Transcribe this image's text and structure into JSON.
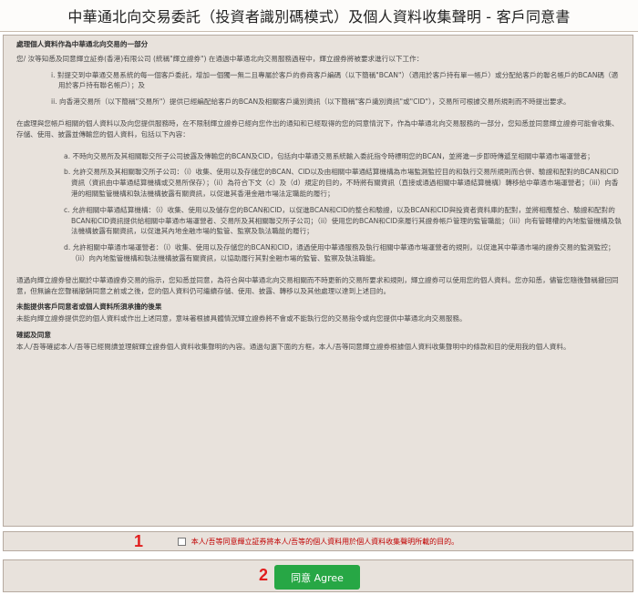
{
  "title": "中華通北向交易委託（投資者識別碼模式）及個人資料收集聲明 - 客戶同意書",
  "notice": {
    "heading1": "處理個人資料作為中華通北向交易的一部分",
    "intro": "您/ 汝等知悉及同意輝立証券(香港)有限公司 (統稱\"輝立證券\") 在通過中華通北向交易服務過程中，輝立證券將被要求進行以下工作：",
    "roman_i": "i. 對提交到中華通交易系統的每一個客戶委託，增加一個獨一無二且專屬於客戶的券商客戶編碼（以下簡稱\"BCAN\"）（適用於客戶持有單一帳戶）或分配給客戶的聯名帳戶的BCAN碼（適用於客戶持有聯名帳戶）；及",
    "roman_ii": "ii. 向香港交易所（以下簡稱\"交易所\"）提供已經編配給客戶的BCAN及相關客戶識別資訊（以下簡稱\"客戶識別資訊\"或\"CID\"），交易所可根據交易所規則而不時提出要求。",
    "para2": "在處理與您帳戶相關的個人資料以及向您提供服務時，在不限制輝立證券已經向您作出的通知和已經取得的您的同意情況下，作為中華通北向交易服務的一部分，您知悉並同意輝立證券可能會收集、存儲、使用、披露並傳輸您的個人資料，包括以下內容：",
    "item_a": "a. 不時向交易所及其相關聯交所子公司披露及傳輸您的BCAN及CID，包括向中華通交易系統輸入委託指令時標明您的BCAN，並將進一步即時傳遞至相關中華通市場運營者；",
    "item_b": "b. 允許交易所及其相關聯交所子公司：（i）收集、使用以及存儲您的BCAN、CID以及由相關中華通結算機構為市場監測監控目的和執行交易所規則而合併、驗證和配對的BCAN和CID資訊（資訊由中華通結算機構或交易所保存）；（ii）為符合下文（c）及（d）規定的目的，不時將有關資訊（直接或通過相關中華通結算機構）轉移給中華通市場運營者；（iii）向香港的相關監管機構和執法機構披露有關資訊，以促進其香港金融市場法定職能的履行；",
    "item_c": "c. 允許相關中華通結算機構：（i）收集、使用以及儲存您的BCAN和CID，以促進BCAN和CID的整合和驗證，以及BCAN和CID與投資者資料庫的配對，並將相應整合、驗證和配對的BCAN和CID資訊提供給相關中華通市場運營者、交易所及其相關聯交所子公司；（ii）使用您的BCAN和CID來履行其證券帳戶管理的監管職能；（iii）向有管轄權的內地監管機構及執法機構披露有關資訊，以促進其內地金融市場的監管、監察及執法職能的履行；",
    "item_d": "d. 允許相關中華通市場運營者：（i）收集、使用以及存儲您的BCAN和CID，通過使用中華通服務及執行相關中華通市場運營者的規則，以促進其中華通市場的證券交易的監測監控；（ii）向內地監管機構和執法機構披露有關資訊，以協助履行其對金融市場的監管、監察及執法職能。",
    "para3": "通過向輝立證券發出關於中華通證券交易的指示，您知悉並同意，為符合與中華通北向交易相關而不時更新的交易所要求和規則，輝立證券可以使用您的個人資料。您亦知悉，儘管您隨後聲稱撤回同意，但無論在您聲稱撤銷同意之前或之後，您的個人資料仍可繼續存儲、使用、披露、轉移以及其他處理以達到上述目的。",
    "heading2": "未能提供客戶同意者或個人資料所須承擔的後果",
    "para4": "未能向輝立證券提供您的個人資料或作出上述同意，意味著根據具體情況輝立證券將不會或不能執行您的交易指令或向您提供中華通北向交易服務。",
    "heading3": "確認及同意",
    "para5": "本人/吾等確認本人/吾等已經閱讀並理解輝立證券個人資料收集聲明的內容。通過勾選下面的方框，本人/吾等同意輝立證券根據個人資料收集聲明中的條款和目的使用我的個人資料。"
  },
  "consent": {
    "label": "本人/吾等同意輝立証券將本人/吾等的個人資料用於個人資料收集聲明所載的目的。",
    "color": "#c00000"
  },
  "annotations": {
    "n1": "1",
    "n2": "2"
  },
  "agree_button": {
    "label": "同意 Agree",
    "color": "#27a745"
  }
}
